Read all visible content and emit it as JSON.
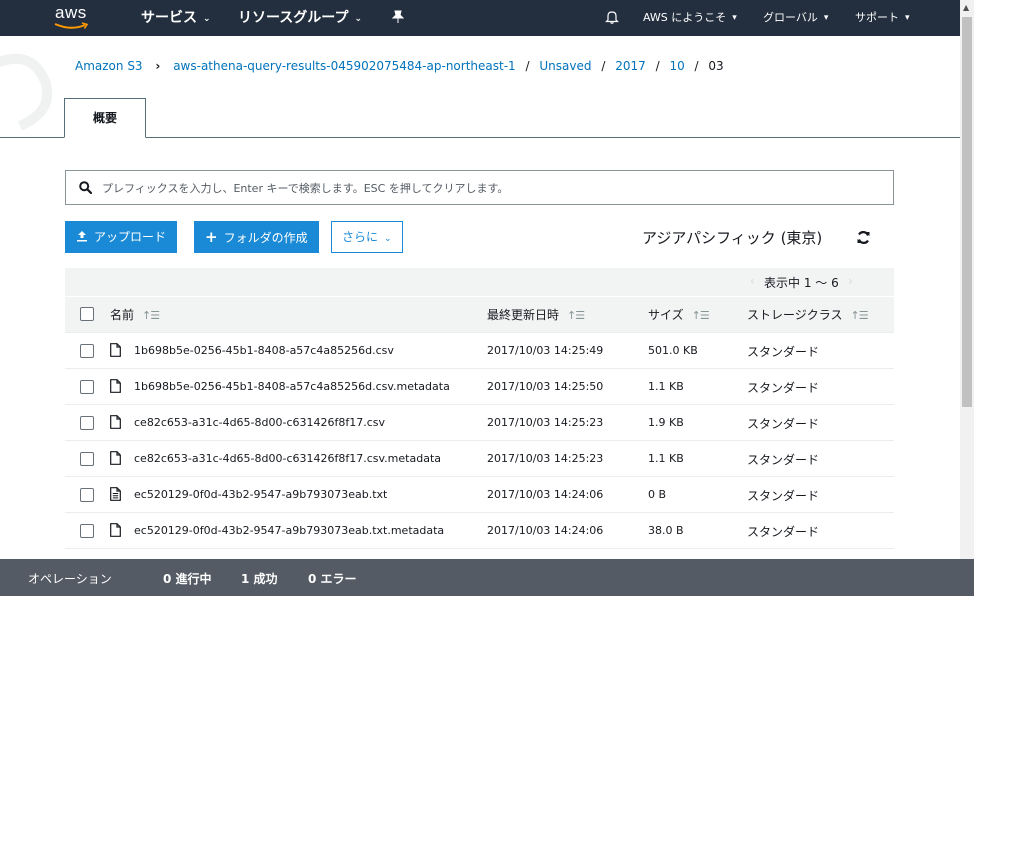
{
  "nav": {
    "logo": "aws",
    "services": "サービス",
    "resource_groups": "リソースグループ",
    "welcome": "AWS にようこそ",
    "global": "グローバル",
    "support": "サポート"
  },
  "breadcrumb": {
    "root": "Amazon S3",
    "bucket": "aws-athena-query-results-045902075484-ap-northeast-1",
    "folders": [
      "Unsaved",
      "2017",
      "10"
    ],
    "current": "03"
  },
  "tabs": {
    "overview": "概要"
  },
  "search": {
    "placeholder": "プレフィックスを入力し、Enter キーで検索します。ESC を押してクリアします。"
  },
  "toolbar": {
    "upload": "アップロード",
    "create_folder": "フォルダの作成",
    "more": "さらに",
    "region": "アジアパシフィック (東京)"
  },
  "table": {
    "paging": "表示中 1 ～ 6",
    "headers": {
      "name": "名前",
      "modified": "最終更新日時",
      "size": "サイズ",
      "storage_class": "ストレージクラス"
    },
    "rows": [
      {
        "name": "1b698b5e-0256-45b1-8408-a57c4a85256d.csv",
        "modified": "2017/10/03 14:25:49",
        "size": "501.0 KB",
        "storage_class": "スタンダード",
        "icon": "file-icon"
      },
      {
        "name": "1b698b5e-0256-45b1-8408-a57c4a85256d.csv.metadata",
        "modified": "2017/10/03 14:25:50",
        "size": "1.1 KB",
        "storage_class": "スタンダード",
        "icon": "file-icon"
      },
      {
        "name": "ce82c653-a31c-4d65-8d00-c631426f8f17.csv",
        "modified": "2017/10/03 14:25:23",
        "size": "1.9 KB",
        "storage_class": "スタンダード",
        "icon": "file-icon"
      },
      {
        "name": "ce82c653-a31c-4d65-8d00-c631426f8f17.csv.metadata",
        "modified": "2017/10/03 14:25:23",
        "size": "1.1 KB",
        "storage_class": "スタンダード",
        "icon": "file-icon"
      },
      {
        "name": "ec520129-0f0d-43b2-9547-a9b793073eab.txt",
        "modified": "2017/10/03 14:24:06",
        "size": "0 B",
        "storage_class": "スタンダード",
        "icon": "text-file-icon"
      },
      {
        "name": "ec520129-0f0d-43b2-9547-a9b793073eab.txt.metadata",
        "modified": "2017/10/03 14:24:06",
        "size": "38.0 B",
        "storage_class": "スタンダード",
        "icon": "file-icon"
      }
    ]
  },
  "operations": {
    "label": "オペレーション",
    "in_progress": "0 進行中",
    "success": "1 成功",
    "errors": "0 エラー"
  },
  "colors": {
    "nav_bg": "#232f3e",
    "primary": "#1b8ad6",
    "link": "#0073bb",
    "ops_bg": "#545b64",
    "aws_orange": "#ff9900"
  }
}
